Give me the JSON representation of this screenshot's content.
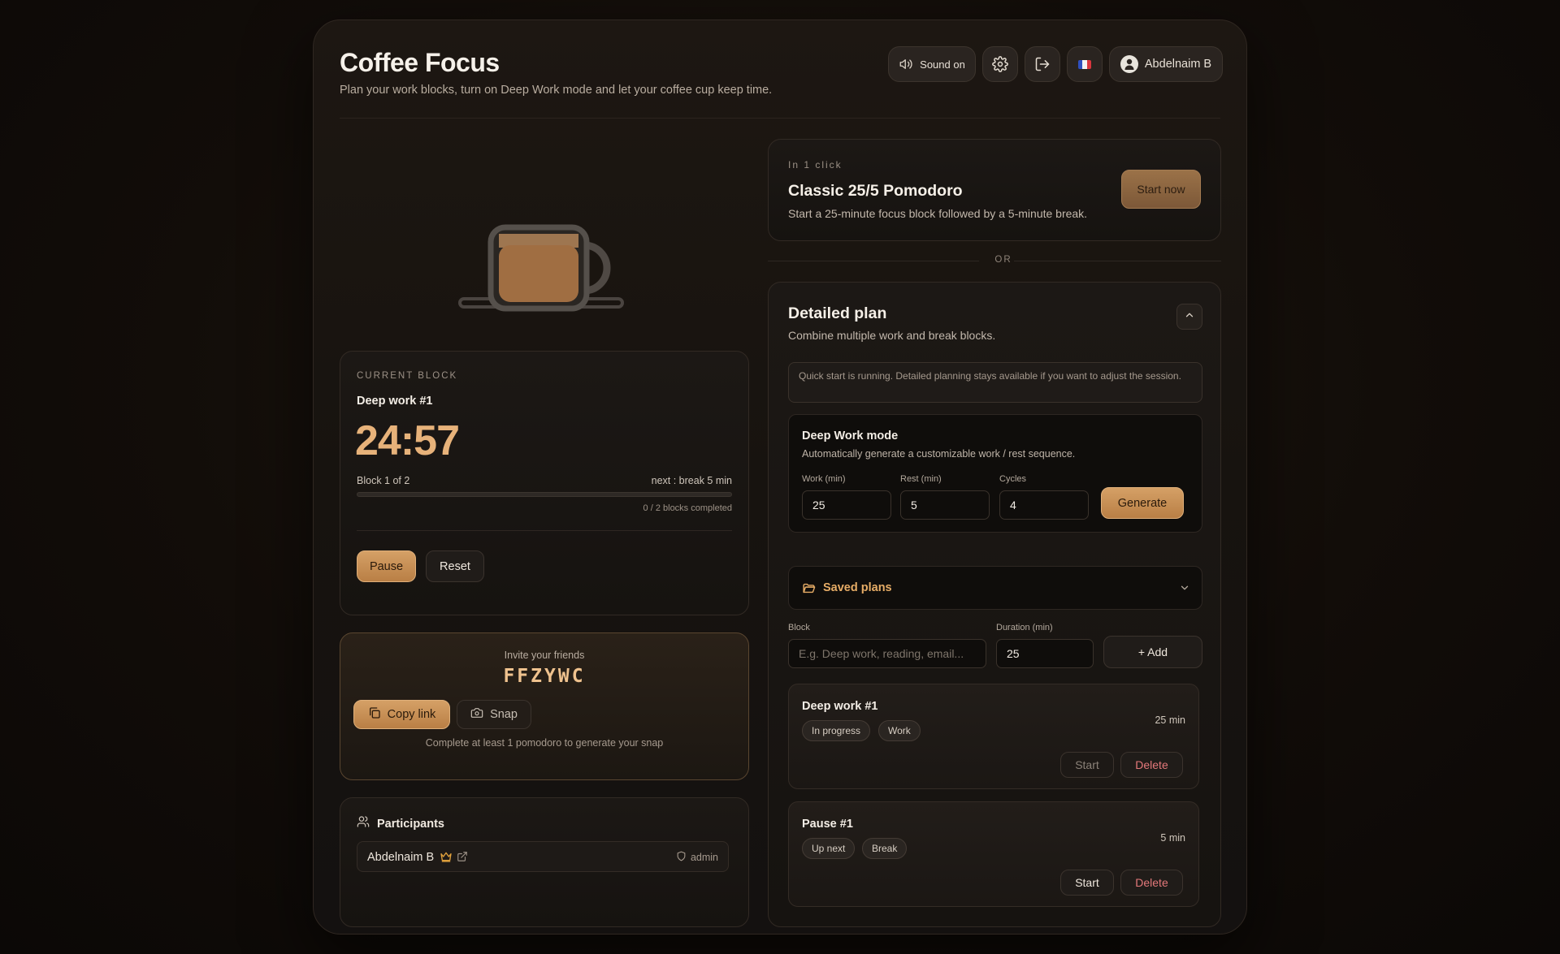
{
  "app": {
    "title": "Coffee Focus",
    "subtitle": "Plan your work blocks, turn on Deep Work mode and let your coffee cup keep time."
  },
  "header": {
    "sound_label": "Sound on",
    "user_name": "Abdelnaim B",
    "language_flag": "FR"
  },
  "current_block": {
    "label": "CURRENT BLOCK",
    "name": "Deep work #1",
    "timer": "24:57",
    "block_counter": "Block 1 of 2",
    "next_info": "next : break 5 min",
    "progress": 0.0,
    "completed": "0 / 2 blocks completed",
    "pause_label": "Pause",
    "reset_label": "Reset"
  },
  "invite": {
    "label": "Invite your friends",
    "code": "FFZYWC",
    "copy_label": "Copy link",
    "snap_label": "Snap",
    "note": "Complete at least 1 pomodoro to generate your snap"
  },
  "participants": {
    "title": "Participants",
    "list": [
      {
        "name": "Abdelnaim B",
        "role": "admin"
      }
    ]
  },
  "quick_start": {
    "eyebrow": "In 1 click",
    "title": "Classic 25/5 Pomodoro",
    "description": "Start a 25-minute focus block followed by a 5-minute break.",
    "button": "Start now"
  },
  "divider_text": "OR",
  "detailed_plan": {
    "title": "Detailed plan",
    "description": "Combine multiple work and break blocks.",
    "notice": "Quick start is running. Detailed planning stays available if you want to adjust the session.",
    "deep_work": {
      "title": "Deep Work mode",
      "description": "Automatically generate a customizable work / rest sequence.",
      "work_label": "Work (min)",
      "work_value": "25",
      "rest_label": "Rest (min)",
      "rest_value": "5",
      "cycles_label": "Cycles",
      "cycles_value": "4",
      "generate_label": "Generate"
    },
    "saved_plans_label": "Saved plans",
    "add_form": {
      "block_label": "Block",
      "block_placeholder": "E.g. Deep work, reading, email...",
      "duration_label": "Duration (min)",
      "duration_value": "25",
      "add_label": "+ Add"
    },
    "blocks": [
      {
        "name": "Deep work #1",
        "status": "In progress",
        "type": "Work",
        "duration": "25 min",
        "start_label": "Start",
        "delete_label": "Delete"
      },
      {
        "name": "Pause #1",
        "status": "Up next",
        "type": "Break",
        "duration": "5 min",
        "start_label": "Start",
        "delete_label": "Delete"
      }
    ]
  },
  "colors": {
    "accent": "#d5a066",
    "danger": "#e3787a",
    "background": "#120d09"
  }
}
